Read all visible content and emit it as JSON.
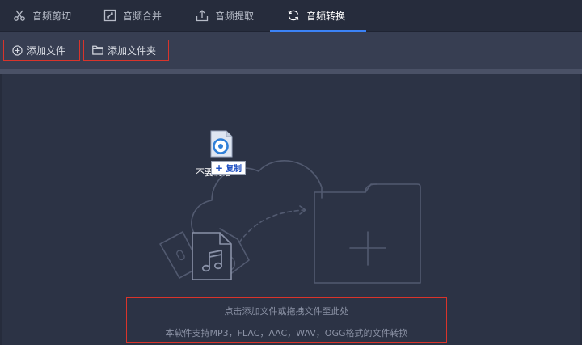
{
  "tabs": [
    {
      "label": "音频剪切",
      "icon": "scissors-icon"
    },
    {
      "label": "音频合并",
      "icon": "merge-icon"
    },
    {
      "label": "音频提取",
      "icon": "extract-icon"
    },
    {
      "label": "音频转换",
      "icon": "convert-icon",
      "active": true
    }
  ],
  "toolbar": {
    "add_file_label": "添加文件",
    "add_folder_label": "添加文件夹"
  },
  "drag": {
    "filename": "不要说话",
    "copy_label": "复制"
  },
  "dropzone": {
    "hint_primary": "点击添加文件或拖拽文件至此处",
    "hint_secondary": "本软件支持MP3，FLAC，AAC，WAV，OGG格式的文件转换"
  },
  "colors": {
    "accent": "#3b82f6",
    "highlight_border": "#d9342b",
    "background": "#2c3345"
  }
}
